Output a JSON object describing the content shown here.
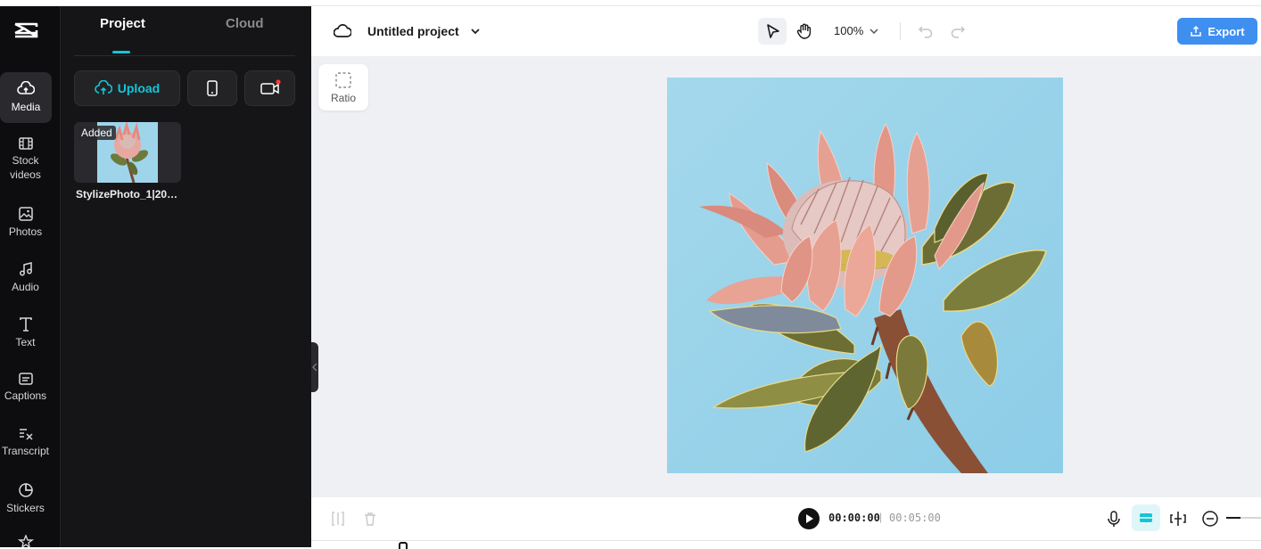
{
  "app": {
    "project_title": "Untitled project",
    "zoom": "100%"
  },
  "sidebar": {
    "items": [
      {
        "label": "Media",
        "icon": "media-cloud-icon",
        "active": true
      },
      {
        "label": "Stock videos",
        "icon": "film-icon"
      },
      {
        "label": "Photos",
        "icon": "image-icon"
      },
      {
        "label": "Audio",
        "icon": "music-note-icon"
      },
      {
        "label": "Text",
        "icon": "text-t-icon"
      },
      {
        "label": "Captions",
        "icon": "captions-icon"
      },
      {
        "label": "Transcript",
        "icon": "transcript-icon"
      },
      {
        "label": "Stickers",
        "icon": "sticker-icon"
      }
    ]
  },
  "panel": {
    "tabs": [
      {
        "label": "Project",
        "active": true
      },
      {
        "label": "Cloud",
        "active": false
      }
    ],
    "upload_label": "Upload",
    "media_items": [
      {
        "badge": "Added",
        "name": "StylizePhoto_1|202..."
      }
    ]
  },
  "canvas": {
    "ratio_label": "Ratio"
  },
  "header": {
    "export_label": "Export"
  },
  "playback": {
    "current_time": "00:00:00",
    "separator": "|",
    "total_time": "00:05:00"
  },
  "colors": {
    "accent": "#12c6d8",
    "export": "#3e8ff0",
    "sidebar_bg": "#0d0d0f",
    "panel_bg": "#151517",
    "canvas_bg": "#eff0f4"
  }
}
